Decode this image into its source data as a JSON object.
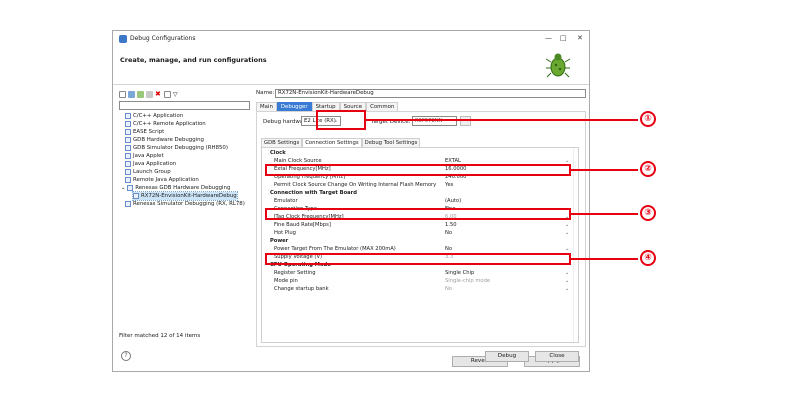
{
  "window": {
    "title": "Debug Configurations",
    "header": "Create, manage, and run configurations",
    "minimize": "—",
    "maximize": "□",
    "close": "✕"
  },
  "left": {
    "filter_value": "",
    "items": [
      {
        "label": "C/C++ Application"
      },
      {
        "label": "C/C++ Remote Application"
      },
      {
        "label": "EASE Script"
      },
      {
        "label": "GDB Hardware Debugging"
      },
      {
        "label": "GDB Simulator Debugging (RH850)"
      },
      {
        "label": "Java Applet"
      },
      {
        "label": "Java Application"
      },
      {
        "label": "Launch Group"
      },
      {
        "label": "Remote Java Application"
      },
      {
        "label": "Renesas GDB Hardware Debugging"
      },
      {
        "label": "RX72N-EnvisionKit-HardwareDebug"
      },
      {
        "label": "Renesas Simulator Debugging (RX, RL78)"
      }
    ],
    "status": "Filter matched 12 of 14 items"
  },
  "right": {
    "name_label": "Name:",
    "name_value": "RX72N-EnvisionKit-HardwareDebug",
    "tabs": [
      "Main",
      "Debugger",
      "Startup",
      "Source",
      "Common"
    ],
    "debug_hw_label": "Debug hardware:",
    "debug_hw_value": "E2 Lite (RX)",
    "target_label": "Target Device:",
    "target_value": "R5F572NN",
    "subtabs": [
      "GDB Settings",
      "Connection Settings",
      "Debug Tool Settings"
    ],
    "rows": [
      {
        "k": "Clock",
        "v": ""
      },
      {
        "k": "Main Clock Source",
        "v": "EXTAL"
      },
      {
        "k": "Extal Frequency[MHz]",
        "v": "16.0000"
      },
      {
        "k": "Operating Frequency [MHz]",
        "v": "240.000"
      },
      {
        "k": "Permit Clock Source Change On Writing Internal Flash Memory",
        "v": "Yes"
      },
      {
        "k": "Connection with Target Board",
        "v": ""
      },
      {
        "k": "Emulator",
        "v": "(Auto)"
      },
      {
        "k": "Connection Type",
        "v": "Fine"
      },
      {
        "k": "JTag Clock Frequency[MHz]",
        "v": "6.00"
      },
      {
        "k": "Fine Baud Rate[Mbps]",
        "v": "1.50"
      },
      {
        "k": "Hot Plug",
        "v": "No"
      },
      {
        "k": "Power",
        "v": ""
      },
      {
        "k": "Power Target From The Emulator (MAX 200mA)",
        "v": "No"
      },
      {
        "k": "Supply Voltage (V)",
        "v": "3.3"
      },
      {
        "k": "CPU Operating Mode",
        "v": ""
      },
      {
        "k": "Register Setting",
        "v": "Single Chip"
      },
      {
        "k": "Mode pin",
        "v": "Single-chip mode"
      },
      {
        "k": "Change startup bank",
        "v": "No"
      }
    ],
    "revert": "Revert",
    "apply": "Apply"
  },
  "bottom": {
    "help": "?",
    "debug": "Debug",
    "close": "Close"
  },
  "annotations": [
    "①",
    "②",
    "③",
    "④"
  ],
  "colors": {
    "highlight": "#e60012",
    "tab_active": "#3a7bd5"
  }
}
